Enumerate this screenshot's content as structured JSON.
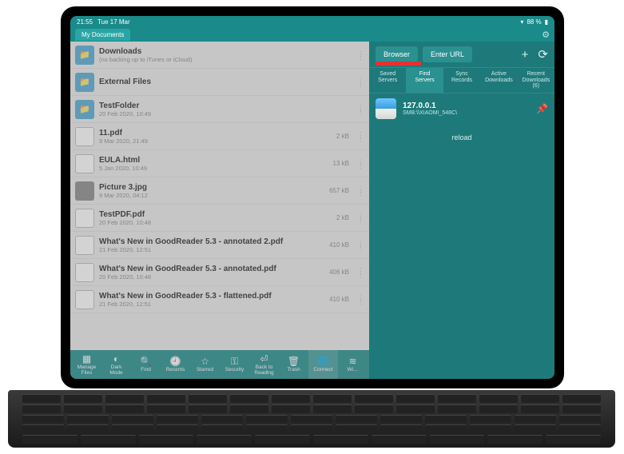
{
  "status": {
    "time": "21:55",
    "date": "Tue 17 Mar",
    "battery": "88 %"
  },
  "tabs": {
    "my_documents": "My Documents"
  },
  "files": [
    {
      "name": "Downloads",
      "sub": "(no backing up to iTunes or iCloud)",
      "size": "",
      "type": "folder"
    },
    {
      "name": "External Files",
      "sub": "",
      "size": "",
      "type": "folder"
    },
    {
      "name": "TestFolder",
      "sub": "20 Feb 2020, 10:49",
      "size": "",
      "type": "folder"
    },
    {
      "name": "11.pdf",
      "sub": "9 Mar 2020, 21:49",
      "size": "2 kB",
      "type": "doc"
    },
    {
      "name": "EULA.html",
      "sub": "5 Jan 2020, 10:49",
      "size": "13 kB",
      "type": "doc"
    },
    {
      "name": "Picture 3.jpg",
      "sub": "9 Mar 2020, 04:12",
      "size": "657 kB",
      "type": "img"
    },
    {
      "name": "TestPDF.pdf",
      "sub": "20 Feb 2020, 10:48",
      "size": "2 kB",
      "type": "doc"
    },
    {
      "name": "What's New in GoodReader 5.3 - annotated 2.pdf",
      "sub": "21 Feb 2020, 12:51",
      "size": "410 kB",
      "type": "doc"
    },
    {
      "name": "What's New in GoodReader 5.3 - annotated.pdf",
      "sub": "20 Feb 2020, 10:48",
      "size": "406 kB",
      "type": "doc"
    },
    {
      "name": "What's New in GoodReader 5.3 - flattened.pdf",
      "sub": "21 Feb 2020, 12:51",
      "size": "410 kB",
      "type": "doc"
    }
  ],
  "toolbar": [
    {
      "label": "Manage\nFiles",
      "icon": "table"
    },
    {
      "label": "Dark\nMode",
      "icon": "moon"
    },
    {
      "label": "Find",
      "icon": "search"
    },
    {
      "label": "Recents",
      "icon": "clock"
    },
    {
      "label": "Starred",
      "icon": "star"
    },
    {
      "label": "Security",
      "icon": "key"
    },
    {
      "label": "Back to\nReading",
      "icon": "back"
    },
    {
      "label": "Trash",
      "icon": "trash"
    },
    {
      "label": "Connect",
      "icon": "globe",
      "selected": true
    },
    {
      "label": "Wi…",
      "icon": "wifi"
    }
  ],
  "right": {
    "browser_btn": "Browser",
    "enter_url_btn": "Enter URL",
    "tabs": {
      "saved": "Saved\nServers",
      "find": "Find\nServers",
      "sync": "Sync\nRecords",
      "active": "Active\nDownloads",
      "recent": "Recent\nDownloads\n(6)"
    },
    "server_title": "127.0.0.1",
    "server_sub": "SMB:\\\\XIAOMI_548C\\",
    "reload": "reload"
  }
}
